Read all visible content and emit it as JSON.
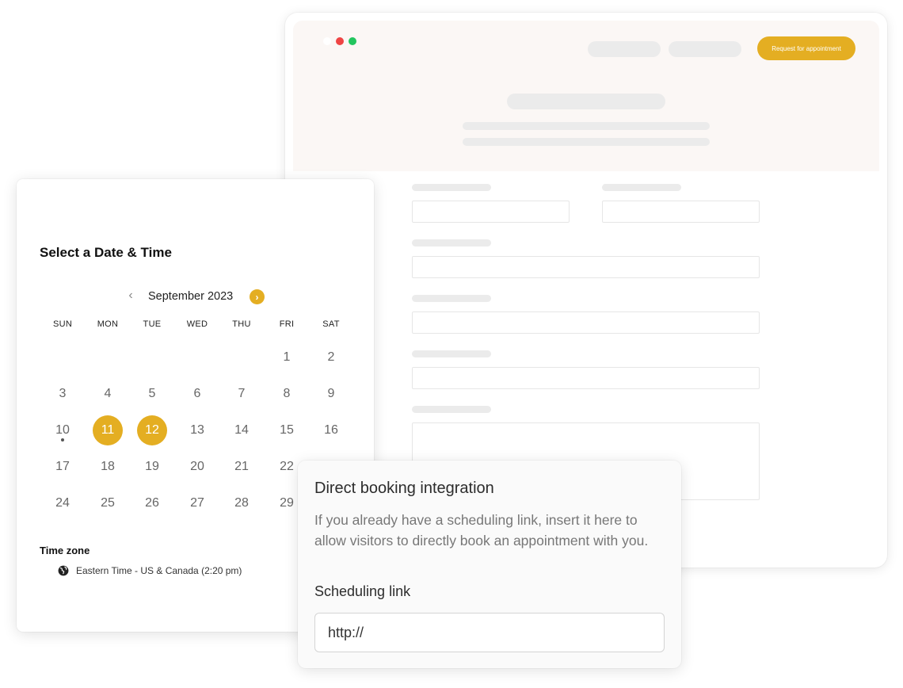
{
  "browser": {
    "cta_label": "Request for appointment",
    "accent_color": "#e4ae22"
  },
  "calendar": {
    "title": "Select a Date & Time",
    "month_label": "September 2023",
    "prev_icon": "chevron-left-icon",
    "next_icon": "chevron-right-icon",
    "weekdays": [
      "SUN",
      "MON",
      "TUE",
      "WED",
      "THU",
      "FRI",
      "SAT"
    ],
    "weeks": [
      [
        "",
        "",
        "",
        "",
        "",
        "1",
        "2"
      ],
      [
        "3",
        "4",
        "5",
        "6",
        "7",
        "8",
        "9"
      ],
      [
        "10",
        "11",
        "12",
        "13",
        "14",
        "15",
        "16"
      ],
      [
        "17",
        "18",
        "19",
        "20",
        "21",
        "22",
        ""
      ],
      [
        "24",
        "25",
        "26",
        "27",
        "28",
        "29",
        ""
      ]
    ],
    "selected_days": [
      "11",
      "12"
    ],
    "today": "10",
    "timezone_title": "Time zone",
    "timezone_icon": "globe-icon",
    "timezone_value": "Eastern Time - US & Canada (2:20 pm)"
  },
  "booking": {
    "title": "Direct booking integration",
    "description": "If you already have a scheduling link, insert it here to allow visitors to directly book an appointment with you.",
    "field_label": "Scheduling link",
    "field_value": "http://"
  }
}
